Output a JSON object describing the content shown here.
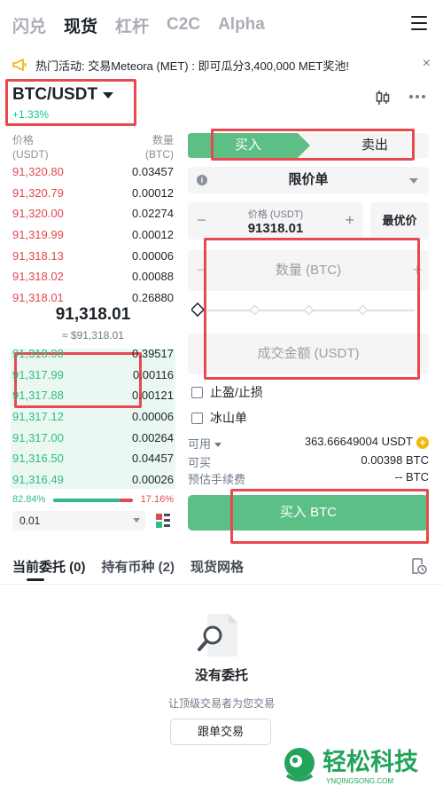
{
  "topnav": {
    "tabs": [
      "闪兑",
      "现货",
      "杠杆",
      "C2C",
      "Alpha"
    ],
    "active_index": 1
  },
  "announcement": {
    "text": "热门活动: 交易Meteora (MET) : 即可瓜分3,400,000 MET奖池!",
    "close": "×"
  },
  "pair": {
    "name": "BTC/USDT",
    "change": "+1.33%"
  },
  "orderbook": {
    "price_label": "价格",
    "price_unit": "(USDT)",
    "qty_label": "数量",
    "qty_unit": "(BTC)",
    "asks": [
      {
        "price": "91,320.80",
        "qty": "0.03457"
      },
      {
        "price": "91,320.79",
        "qty": "0.00012"
      },
      {
        "price": "91,320.00",
        "qty": "0.02274"
      },
      {
        "price": "91,319.99",
        "qty": "0.00012"
      },
      {
        "price": "91,318.13",
        "qty": "0.00006"
      },
      {
        "price": "91,318.02",
        "qty": "0.00088"
      },
      {
        "price": "91,318.01",
        "qty": "0.26880"
      }
    ],
    "mid_price": "91,318.01",
    "mid_fiat": "≈ $91,318.01",
    "bids": [
      {
        "price": "91,318.00",
        "qty": "0.39517"
      },
      {
        "price": "91,317.99",
        "qty": "0.00116"
      },
      {
        "price": "91,317.88",
        "qty": "0.00121"
      },
      {
        "price": "91,317.12",
        "qty": "0.00006"
      },
      {
        "price": "91,317.00",
        "qty": "0.00264"
      },
      {
        "price": "91,316.50",
        "qty": "0.04457"
      },
      {
        "price": "91,316.49",
        "qty": "0.00026"
      }
    ],
    "buy_ratio": "82.84%",
    "sell_ratio": "17.16%",
    "buy_ratio_fraction": 0.8284,
    "depth": "0.01"
  },
  "form": {
    "buy_tab": "买入",
    "sell_tab": "卖出",
    "order_type": "限价单",
    "price_label": "价格 (USDT)",
    "price_value": "91318.01",
    "best_price": "最优价",
    "qty_placeholder": "数量 (BTC)",
    "amount_placeholder": "成交金额 (USDT)",
    "tpsl": "止盈/止损",
    "iceberg": "冰山单",
    "available_label": "可用",
    "available_value": "363.66649004 USDT",
    "can_buy_label": "可买",
    "can_buy_value": "0.00398 BTC",
    "fee_label": "预估手续费",
    "fee_value": "-- BTC",
    "buy_button": "买入 BTC"
  },
  "bottom": {
    "tabs": [
      "当前委托 (0)",
      "持有币种 (2)",
      "现货网格"
    ],
    "empty_title": "没有委托",
    "empty_sub": "让顶级交易者为您交易",
    "copy_button": "跟单交易"
  },
  "watermark": {
    "cn": "轻松科技",
    "en": "YNQINGSONG.COM"
  },
  "colors": {
    "buy": "#5cbf86",
    "sell_text": "#e0494f",
    "bid_text": "#2ebd85",
    "annotation": "#e8494e",
    "brand_green": "#22a45a"
  }
}
